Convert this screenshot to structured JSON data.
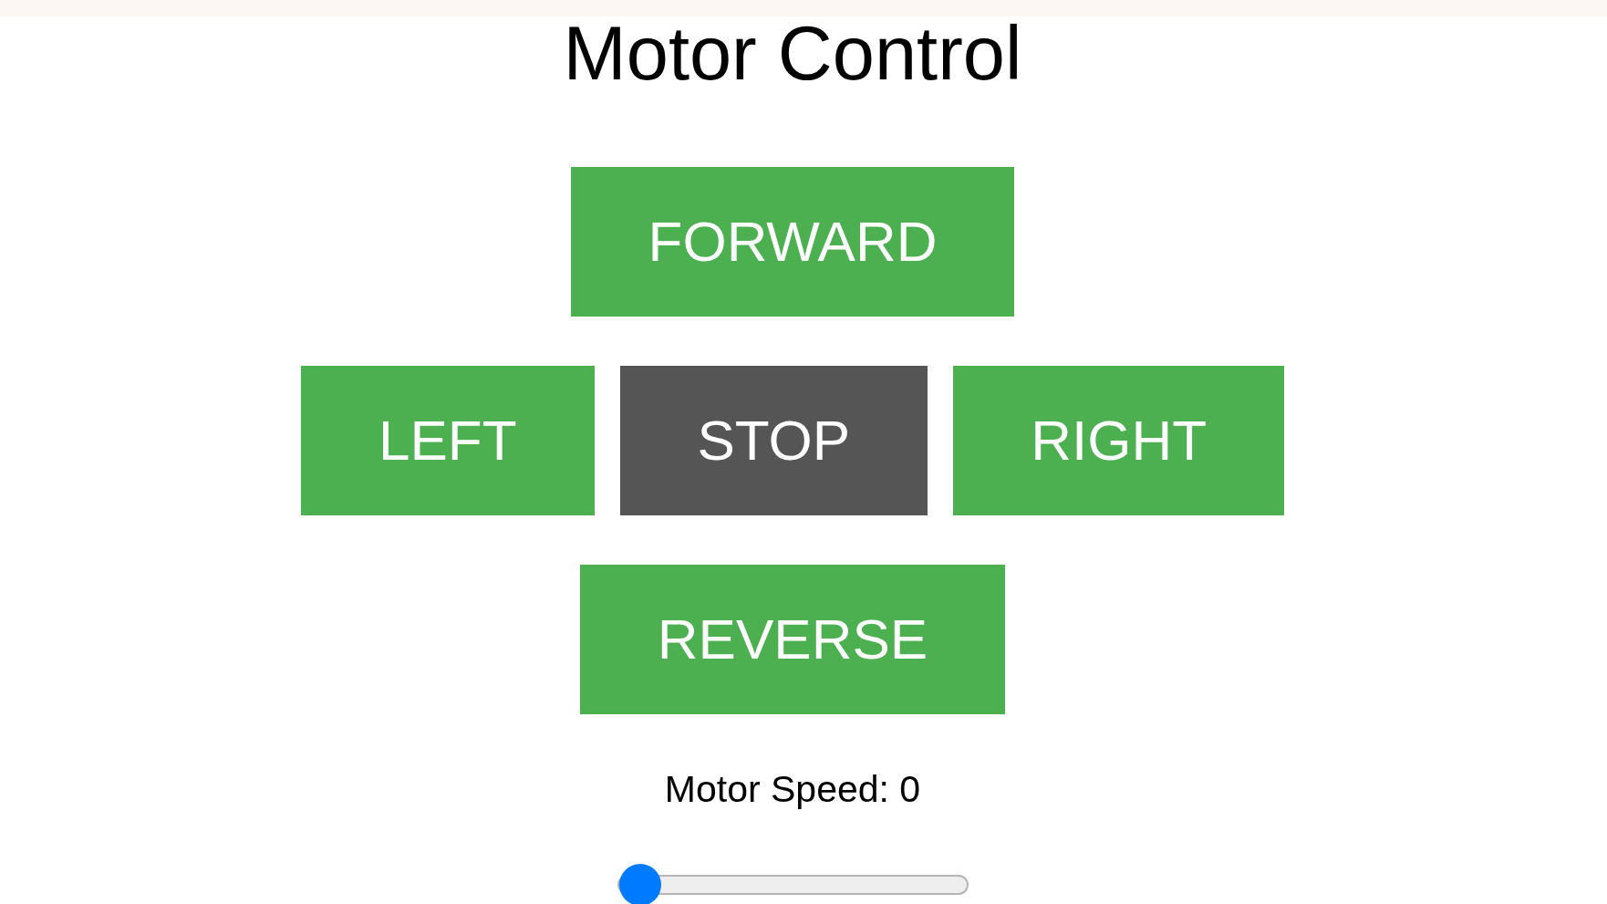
{
  "title": "Motor Control",
  "button_rows": [
    {
      "buttons": [
        {
          "label": "FORWARD",
          "selected": false
        }
      ]
    },
    {
      "buttons": [
        {
          "label": "LEFT",
          "selected": false
        },
        {
          "label": "STOP",
          "selected": true
        },
        {
          "label": "RIGHT",
          "selected": false
        }
      ]
    },
    {
      "buttons": [
        {
          "label": "REVERSE",
          "selected": false
        }
      ]
    }
  ],
  "speed": {
    "readout": "Motor Speed: 0",
    "slider": {
      "level": 0
    }
  }
}
